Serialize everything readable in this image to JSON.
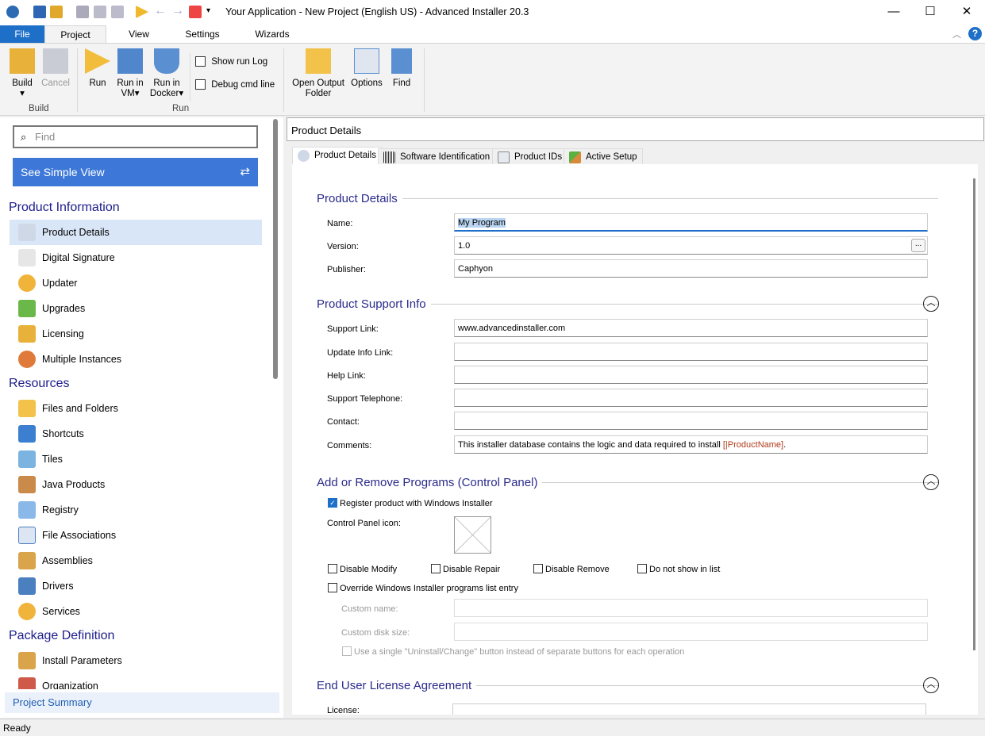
{
  "window": {
    "title": "Your Application - New Project (English US) - Advanced Installer 20.3",
    "minimize": "—",
    "maximize": "☐",
    "close": "✕"
  },
  "ribbon_tabs": [
    "File",
    "Project",
    "View",
    "Settings",
    "Wizards"
  ],
  "ribbon": {
    "build": "Build",
    "cancel": "Cancel",
    "group_build": "Build",
    "run": "Run",
    "run_vm": "Run in VM",
    "run_docker": "Run in Docker",
    "show_run_log": "Show run Log",
    "debug_cmd": "Debug cmd line",
    "group_run": "Run",
    "open_output": "Open Output Folder",
    "options": "Options",
    "find": "Find",
    "help": "?"
  },
  "sidebar": {
    "find_placeholder": "Find",
    "simple_view": "See Simple View",
    "sections": [
      {
        "title": "Product Information",
        "items": [
          "Product Details",
          "Digital Signature",
          "Updater",
          "Upgrades",
          "Licensing",
          "Multiple Instances"
        ]
      },
      {
        "title": "Resources",
        "items": [
          "Files and Folders",
          "Shortcuts",
          "Tiles",
          "Java Products",
          "Registry",
          "File Associations",
          "Assemblies",
          "Drivers",
          "Services"
        ]
      },
      {
        "title": "Package Definition",
        "items": [
          "Install Parameters",
          "Organization"
        ]
      }
    ],
    "selected": "Product Details",
    "project_summary": "Project Summary"
  },
  "page": {
    "header": "Product Details",
    "tabs": [
      "Product Details",
      "Software Identification",
      "Product IDs",
      "Active Setup"
    ],
    "product_details": {
      "title": "Product Details",
      "name_label": "Name:",
      "name": "My Program",
      "version_label": "Version:",
      "version": "1.0",
      "version_btn": "...",
      "publisher_label": "Publisher:",
      "publisher": "Caphyon"
    },
    "support": {
      "title": "Product Support Info",
      "support_link_label": "Support Link:",
      "support_link": "www.advancedinstaller.com",
      "update_label": "Update Info Link:",
      "help_label": "Help Link:",
      "tel_label": "Support Telephone:",
      "contact_label": "Contact:",
      "comments_label": "Comments:",
      "comments": "This installer database contains the logic and data required to install ",
      "comments_prop": "[|ProductName]",
      "comments_end": "."
    },
    "arp": {
      "title": "Add or Remove Programs (Control Panel)",
      "register": "Register product with Windows Installer",
      "register_checked": true,
      "cp_icon": "Control Panel icon:",
      "disable_modify": "Disable Modify",
      "disable_repair": "Disable Repair",
      "disable_remove": "Disable Remove",
      "not_show": "Do not show in list",
      "override": "Override Windows Installer programs list entry",
      "custom_name": "Custom name:",
      "custom_size": "Custom disk size:",
      "single_button": "Use a single \"Uninstall/Change\" button instead of separate buttons for each operation"
    },
    "eula": {
      "title": "End User License Agreement",
      "license_label": "License:"
    }
  },
  "status": "Ready",
  "colors": {
    "accent": "#3d78d8",
    "file_tab": "#1e6fc8",
    "heading": "#2a2a8c"
  }
}
